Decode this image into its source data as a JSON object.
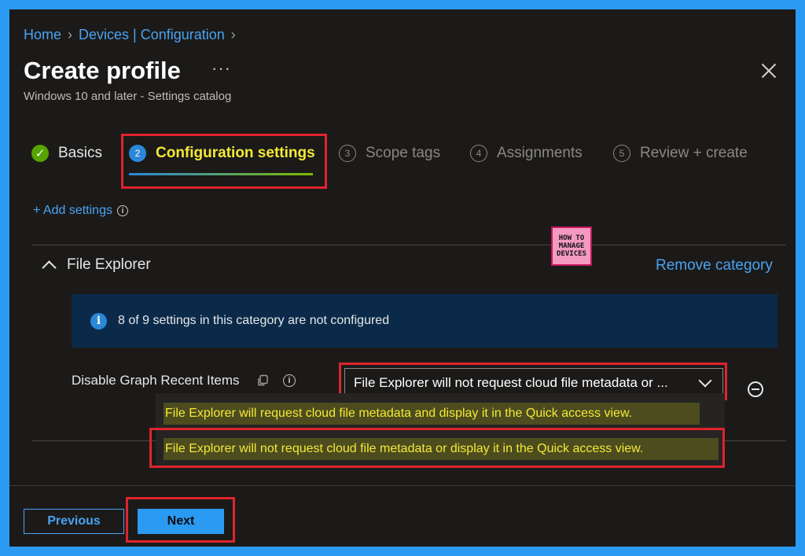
{
  "breadcrumb": {
    "items": [
      "Home",
      "Devices | Configuration"
    ]
  },
  "header": {
    "title": "Create profile",
    "more_label": "···",
    "subtitle": "Windows 10 and later - Settings catalog"
  },
  "steps": [
    {
      "number": "✓",
      "label": "Basics",
      "state": "done"
    },
    {
      "number": "2",
      "label": "Configuration settings",
      "state": "active"
    },
    {
      "number": "3",
      "label": "Scope tags",
      "state": "todo"
    },
    {
      "number": "4",
      "label": "Assignments",
      "state": "todo"
    },
    {
      "number": "5",
      "label": "Review + create",
      "state": "todo"
    }
  ],
  "add_settings": {
    "label": "+ Add settings",
    "info": "i"
  },
  "category": {
    "title": "File Explorer",
    "remove_label": "Remove category",
    "info_banner": "8 of 9 settings in this category are not configured",
    "setting": {
      "label": "Disable Graph Recent Items",
      "selected_value": "File Explorer will not request cloud file metadata or ...",
      "options": [
        "File Explorer will request cloud file metadata and display it in the Quick access view.",
        "File Explorer will not request cloud file metadata or display it in the Quick access view."
      ]
    }
  },
  "logo": {
    "line1": "HOW TO",
    "line2": "MANAGE",
    "line3": "DEVICES"
  },
  "footer": {
    "previous_label": "Previous",
    "next_label": "Next"
  },
  "colors": {
    "accent": "#2b9af3",
    "highlight_text": "#f5e935",
    "annotation_red": "#e0232d",
    "success": "#57a300"
  }
}
